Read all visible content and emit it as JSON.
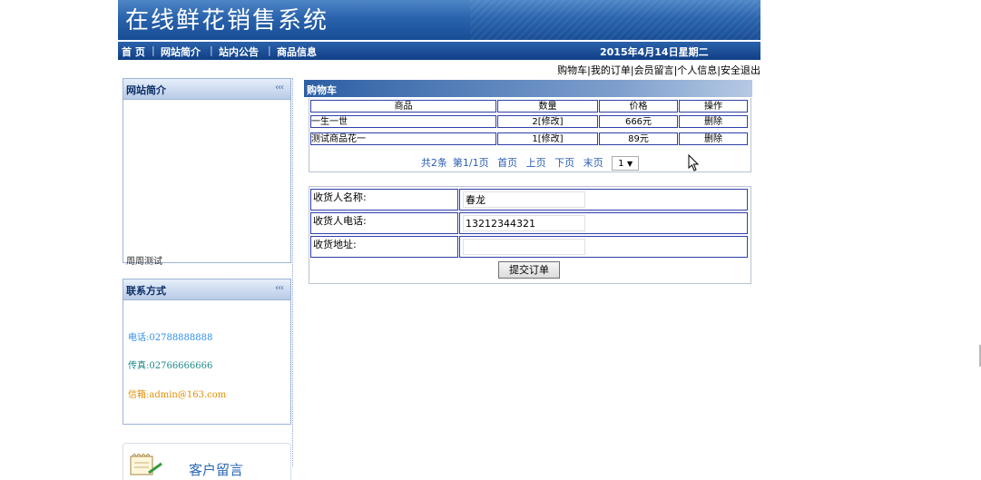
{
  "app": {
    "title": "在线鲜花销售系统"
  },
  "nav": {
    "items": [
      "首 页",
      "网站简介",
      "站内公告",
      "商品信息"
    ],
    "separator": "|",
    "date": "2015年4月14日星期二"
  },
  "user_links": {
    "cart": "购物车",
    "orders": "我的订单",
    "messages": "会员留言",
    "profile": "个人信息",
    "logout": "安全退出",
    "separator": "|"
  },
  "sidebar": {
    "intro": {
      "title": "网站简介",
      "chevron": "‹‹‹",
      "text": "周周测试"
    },
    "contact": {
      "title": "联系方式",
      "chevron": "‹‹‹",
      "phone": "电话:02788888888",
      "fax": "传真:02766666666",
      "email": "信箱:admin@163.com",
      "colors": {
        "phone": "#2f8ff0",
        "fax": "#1d8a8a",
        "email": "#e08f00"
      }
    },
    "messages": {
      "label": "客户留言"
    }
  },
  "cart": {
    "title": "购物车",
    "columns": [
      "商品",
      "数量",
      "价格",
      "操作"
    ],
    "rows": [
      {
        "name": "一生一世",
        "qty": "2[修改]",
        "price": "666元",
        "action": "删除"
      },
      {
        "name": "测试商品花一",
        "qty": "1[修改]",
        "price": "89元",
        "action": "删除"
      }
    ],
    "pager": {
      "summary": "共2条",
      "page_info": "第1/1页",
      "first": "首页",
      "prev": "上页",
      "next": "下页",
      "last": "末页",
      "selected_page": "1"
    }
  },
  "order_form": {
    "name_label": "收货人名称:",
    "name_value": "春龙",
    "phone_label": "收货人电话:",
    "phone_value": "13212344321",
    "address_label": "收货地址:",
    "address_value": "",
    "submit": "提交订单"
  },
  "theme": {
    "header_blue": "#1e5aa5",
    "table_border": "#2f3fa9",
    "link_blue": "#2b5cb3"
  }
}
